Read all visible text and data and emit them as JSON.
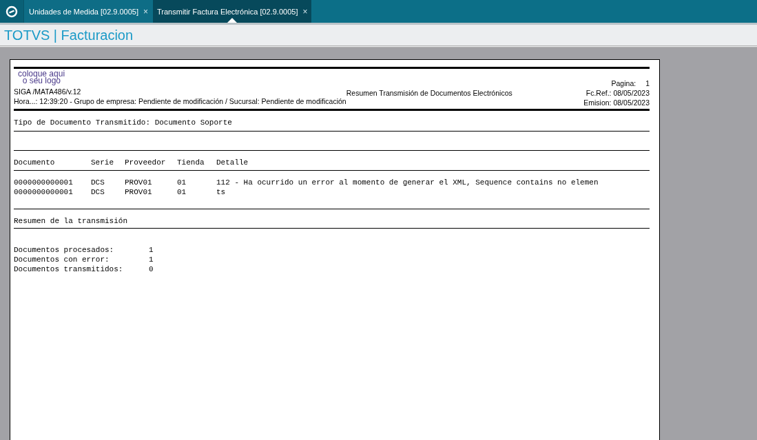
{
  "tabs": [
    {
      "label": "Unidades de Medida [02.9.0005]",
      "selected": false
    },
    {
      "label": "Transmitir Factura Electrónica [02.9.0005]",
      "selected": true
    }
  ],
  "close_glyph": "×",
  "app_title": "TOTVS | Facturacion",
  "report": {
    "logo": [
      "coloque aqui",
      "o seu logo"
    ],
    "header_left": [
      "SIGA /MATA486/v.12",
      "Hora...: 12:39:20 - Grupo de empresa: Pendiente de modificación / Sucursal: Pendiente de modificación"
    ],
    "header_center": "Resumen Transmisión de Documentos Electrónicos",
    "page_label": "Pagina:",
    "page_number": "1",
    "ref_date": "Fc.Ref.: 08/05/2023",
    "emission_date": "Emision: 08/05/2023",
    "document_type": "Tipo de Documento Transmitido: Documento Soporte",
    "table": {
      "columns": [
        "Documento",
        "Serie",
        "Proveedor",
        "Tienda",
        "Detalle"
      ],
      "rows": [
        [
          "0000000000001",
          "DCS",
          "PROV01",
          "01",
          "112 - Ha ocurrido un error al momento de generar el XML, Sequence contains no elemen"
        ],
        [
          "0000000000001",
          "DCS",
          "PROV01",
          "01",
          "ts"
        ]
      ]
    },
    "summary_title": "Resumen de la transmisión",
    "summary": [
      {
        "label": "Documentos procesados:",
        "value": "1"
      },
      {
        "label": "Documentos con error:",
        "value": "1"
      },
      {
        "label": "Documentos transmitidos:",
        "value": "0"
      }
    ]
  }
}
